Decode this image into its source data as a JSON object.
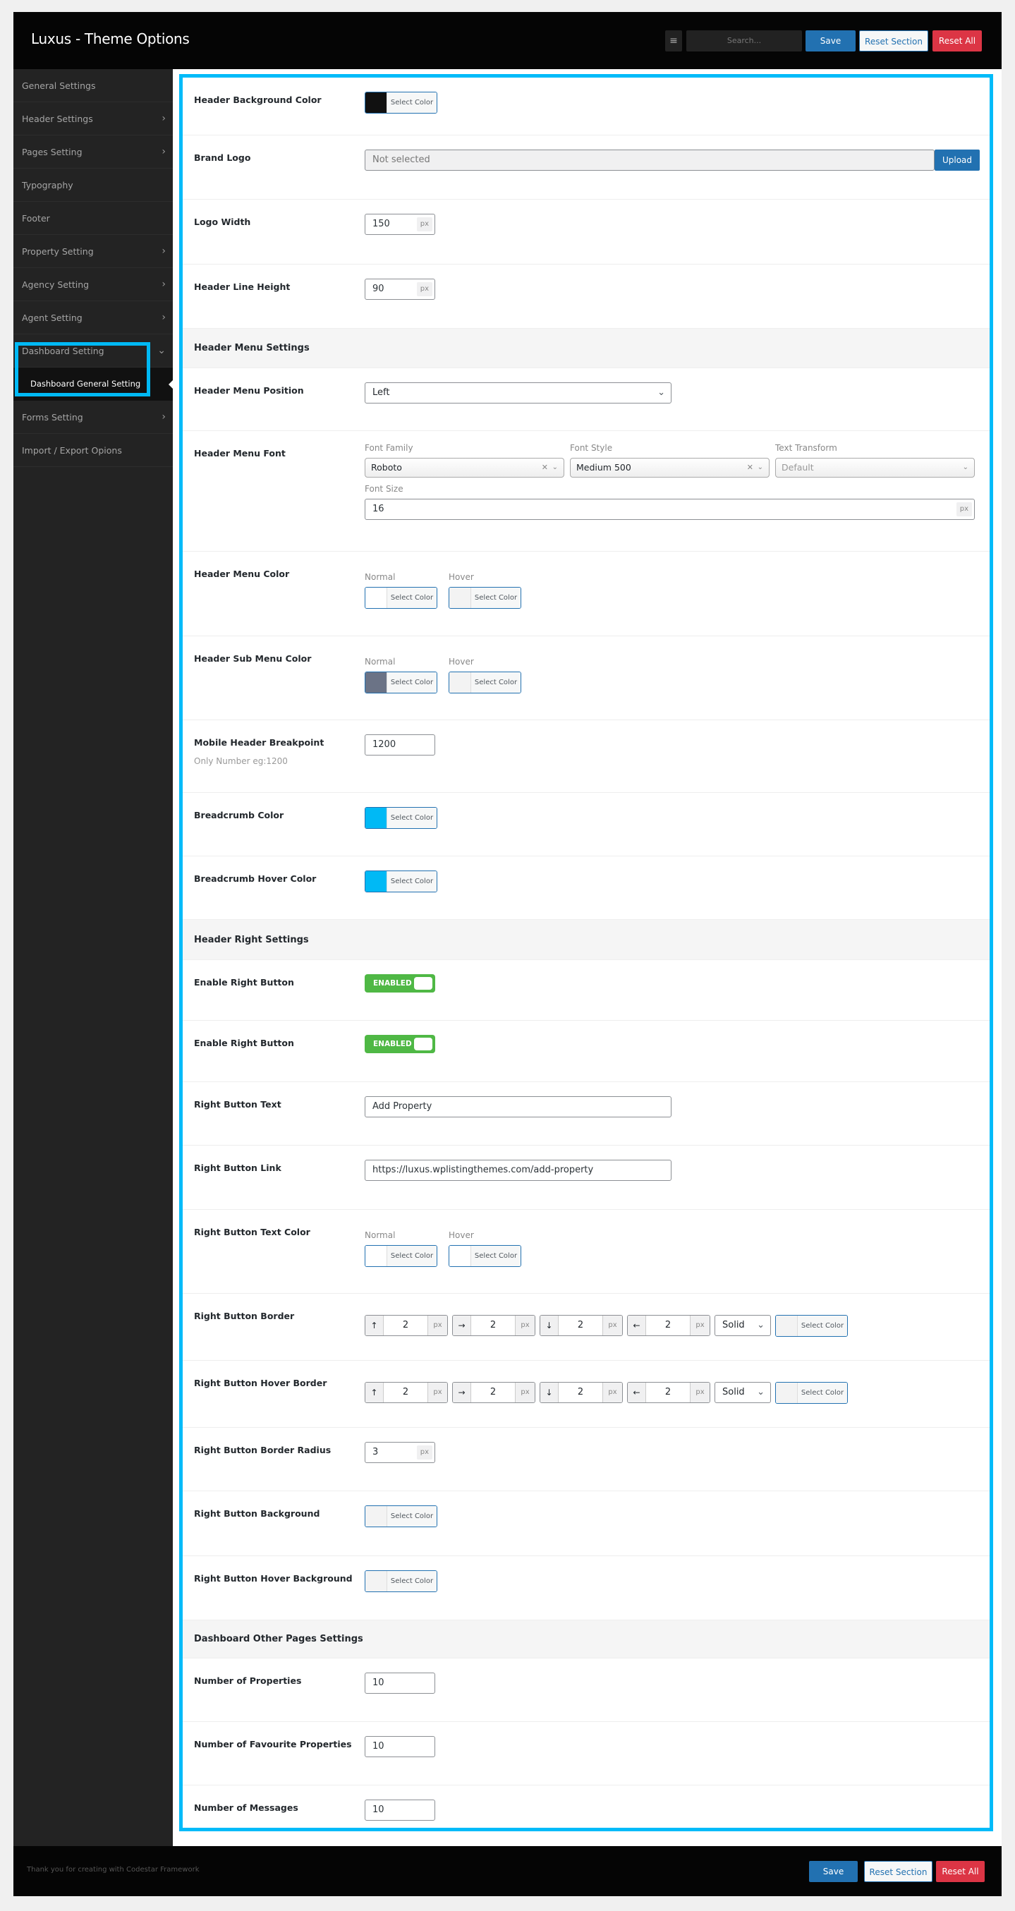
{
  "header": {
    "title": "Luxus - Theme Options",
    "search_placeholder": "Search...",
    "save": "Save",
    "reset_section": "Reset Section",
    "reset_all": "Reset All"
  },
  "sidebar": {
    "items": [
      {
        "label": "General Settings",
        "chevron": ""
      },
      {
        "label": "Header Settings",
        "chevron": "›"
      },
      {
        "label": "Pages Setting",
        "chevron": "›"
      },
      {
        "label": "Typography",
        "chevron": ""
      },
      {
        "label": "Footer",
        "chevron": ""
      },
      {
        "label": "Property Setting",
        "chevron": "›"
      },
      {
        "label": "Agency Setting",
        "chevron": "›"
      },
      {
        "label": "Agent Setting",
        "chevron": "›"
      },
      {
        "label": "Dashboard Setting",
        "chevron": "⌄",
        "sub": "Dashboard General Setting"
      },
      {
        "label": "Forms Setting",
        "chevron": "›"
      },
      {
        "label": "Import / Export Opions",
        "chevron": ""
      }
    ]
  },
  "select_color": "Select Color",
  "rows": [
    {
      "type": "color",
      "label": "Header Background Color",
      "color": "#111111"
    },
    {
      "type": "upload",
      "label": "Brand Logo",
      "value": "Not selected",
      "button": "Upload"
    },
    {
      "type": "number_unit",
      "label": "Logo Width",
      "value": "150",
      "unit": "px"
    },
    {
      "type": "number_unit",
      "label": "Header Line Height",
      "value": "90",
      "unit": "px"
    },
    {
      "type": "section",
      "title": "Header Menu Settings"
    },
    {
      "type": "select",
      "label": "Header Menu Position",
      "value": "Left"
    },
    {
      "type": "typography",
      "label": "Header Menu Font",
      "family_label": "Font Family",
      "family": "Roboto",
      "style_label": "Font Style",
      "style": "Medium 500",
      "transform_label": "Text Transform",
      "transform": "Default",
      "size_label": "Font Size",
      "size": "16",
      "unit": "px"
    },
    {
      "type": "color_pair",
      "label": "Header Menu Color",
      "items": [
        {
          "label": "Normal",
          "color": "#ffffff"
        },
        {
          "label": "Hover",
          "color": "#f3f3f3"
        }
      ]
    },
    {
      "type": "color_pair",
      "label": "Header Sub Menu Color",
      "items": [
        {
          "label": "Normal",
          "color": "#6b7386"
        },
        {
          "label": "Hover",
          "color": "#f3f3f3"
        }
      ]
    },
    {
      "type": "number_sub",
      "label": "Mobile Header Breakpoint",
      "subtitle": "Only Number eg:1200",
      "value": "1200"
    },
    {
      "type": "color",
      "label": "Breadcrumb Color",
      "color": "#00b9f5"
    },
    {
      "type": "color",
      "label": "Breadcrumb Hover Color",
      "color": "#00b9f5"
    },
    {
      "type": "section",
      "title": "Header Right Settings"
    },
    {
      "type": "switch",
      "label": "Enable Right Button",
      "text": "ENABLED"
    },
    {
      "type": "switch",
      "label": "Enable Right Button",
      "text": "ENABLED"
    },
    {
      "type": "text",
      "label": "Right Button Text",
      "value": "Add Property"
    },
    {
      "type": "text",
      "label": "Right Button Link",
      "value": "https://luxus.wplistingthemes.com/add-property"
    },
    {
      "type": "color_pair",
      "label": "Right Button Text Color",
      "items": [
        {
          "label": "Normal",
          "color": "#ffffff"
        },
        {
          "label": "Hover",
          "color": "#ffffff"
        }
      ]
    },
    {
      "type": "border",
      "label": "Right Button Border",
      "sides": [
        {
          "icon": "↑",
          "value": "2",
          "unit": "px"
        },
        {
          "icon": "→",
          "value": "2",
          "unit": "px"
        },
        {
          "icon": "↓",
          "value": "2",
          "unit": "px"
        },
        {
          "icon": "←",
          "value": "2",
          "unit": "px"
        }
      ],
      "style": "Solid",
      "color": "#f3f3f3"
    },
    {
      "type": "border",
      "label": "Right Button Hover Border",
      "sides": [
        {
          "icon": "↑",
          "value": "2",
          "unit": "px"
        },
        {
          "icon": "→",
          "value": "2",
          "unit": "px"
        },
        {
          "icon": "↓",
          "value": "2",
          "unit": "px"
        },
        {
          "icon": "←",
          "value": "2",
          "unit": "px"
        }
      ],
      "style": "Solid",
      "color": "#f3f3f3"
    },
    {
      "type": "number_unit",
      "label": "Right Button Border Radius",
      "value": "3",
      "unit": "px"
    },
    {
      "type": "color",
      "label": "Right Button Background",
      "color": "#f3f3f3"
    },
    {
      "type": "color",
      "label": "Right Button Hover Background",
      "color": "#f3f3f3"
    },
    {
      "type": "section",
      "title": "Dashboard Other Pages Settings"
    },
    {
      "type": "number",
      "label": "Number of Properties",
      "value": "10"
    },
    {
      "type": "number",
      "label": "Number of Favourite Properties",
      "value": "10"
    },
    {
      "type": "number",
      "label": "Number of Messages",
      "value": "10"
    }
  ],
  "footer": {
    "text": "Thank you for creating with Codestar Framework",
    "save": "Save",
    "reset_section": "Reset Section",
    "reset_all": "Reset All"
  },
  "colors": {
    "accent": "#2271b1",
    "danger": "#dc3545",
    "highlight": "#00bbf9",
    "toggle": "#4fb845"
  }
}
